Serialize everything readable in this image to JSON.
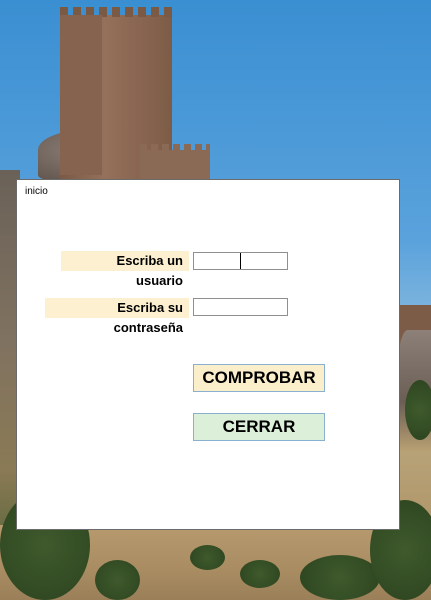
{
  "form": {
    "title": "inicio",
    "username_label": "Escriba un usuario",
    "username_value": "",
    "password_label": "Escriba su contraseña",
    "password_value": "",
    "check_button": "COMPROBAR",
    "close_button": "CERRAR"
  },
  "colors": {
    "label_background": "#fdf0d0",
    "check_button_background": "#fbeecb",
    "close_button_background": "#dcefd8"
  }
}
